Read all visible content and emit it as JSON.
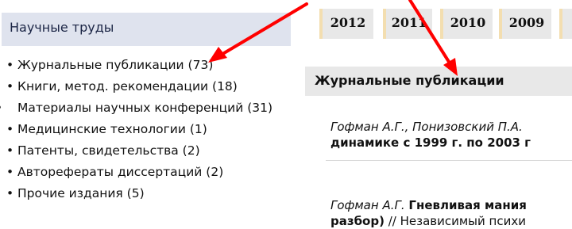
{
  "sidebar": {
    "header": "Научные труды",
    "items": [
      {
        "label": "Журнальные публикации (73)"
      },
      {
        "label": "Книги, метод. рекомендации (18)"
      },
      {
        "label": "Материалы научных конференций (31)"
      },
      {
        "label": "Медицинские технологии (1)"
      },
      {
        "label": "Патенты, свидетельства (2)"
      },
      {
        "label": "Авторефераты диссертаций (2)"
      },
      {
        "label": "Прочие издания (5)"
      }
    ],
    "bullet": "•"
  },
  "tabs": [
    {
      "label": "2012"
    },
    {
      "label": "2011"
    },
    {
      "label": "2010"
    },
    {
      "label": "2009"
    }
  ],
  "section": {
    "title": "Журнальные публикации"
  },
  "publications": [
    {
      "authors": "Гофман А.Г., Понизовский П.А.",
      "title": "динамике с 1999 г. по 2003 г",
      "rest": ""
    },
    {
      "authors": "Гофман А.Г.",
      "title": "Гневливая мания",
      "title2": "разбор)",
      "rest": " // Независимый психи"
    }
  ],
  "colors": {
    "annotation_arrow": "#ff0000",
    "sidebar_header_bg": "#dfe3ee",
    "tab_bg": "#e8e8e8",
    "tab_edge": "#f3deb0"
  }
}
